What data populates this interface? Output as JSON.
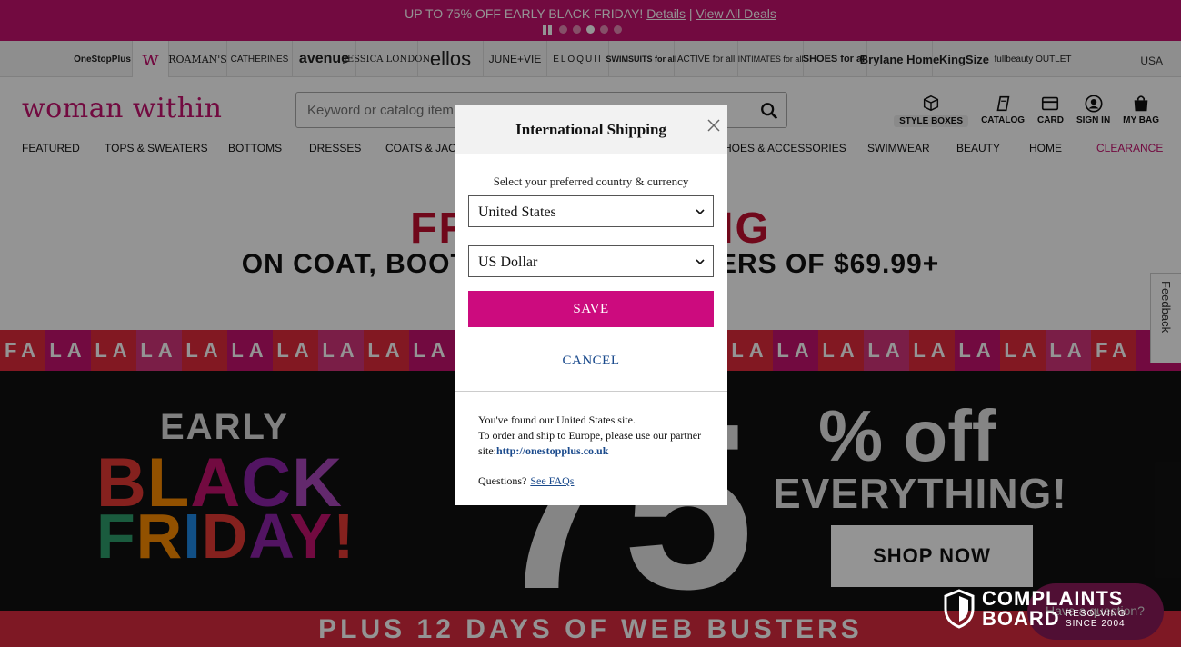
{
  "promo": {
    "text": "UP TO 75% OFF EARLY BLACK FRIDAY!",
    "details_link": "Details",
    "separator": "|",
    "view_all_link": "View All Deals"
  },
  "brands": [
    "OneStopPlus",
    "w",
    "ROAMAN'S",
    "CATHERINES",
    "avenue",
    "JESSICA LONDON",
    "ellos",
    "JUNE+VIE",
    "ELOQUII",
    "SWIMSUITS for all",
    "ACTIVE for all",
    "INTIMATES for all",
    "SHOES for all",
    "Brylane Home",
    "KingSize",
    "fullbeauty OUTLET"
  ],
  "country_code": "USA",
  "header": {
    "logo": "woman within",
    "search_placeholder": "Keyword or catalog item #",
    "icons": {
      "style_boxes": "STYLE BOXES",
      "catalog": "CATALOG",
      "card": "CARD",
      "sign_in": "SIGN IN",
      "bag": "MY BAG"
    }
  },
  "nav": [
    "FEATURED",
    "TOPS & SWEATERS",
    "BOTTOMS",
    "DRESSES",
    "COATS & JACKETS",
    "SHOES & ACCESSORIES",
    "SWIMWEAR",
    "BEAUTY",
    "HOME",
    "CLEARANCE"
  ],
  "banner": {
    "free_title": "FREE SHIPPING",
    "free_sub": "ON COAT, BOOT & SWEATER ORDERS OF $69.99+",
    "fala": "FA LA LA LA LA LA LA LA LA LA LA LA LA LA LA LA LA LA LA LA LA LA LA LA LA FA L",
    "early": "EARLY",
    "black": "BLACK",
    "friday": "FRIDAY!",
    "big_number": "75",
    "off": "% off",
    "everything": "EVERYTHING!",
    "shop_now": "SHOP NOW",
    "plus": "PLUS 12 DAYS OF WEB BUSTERS"
  },
  "feedback": "Feedback",
  "chat": "Have a question?",
  "modal": {
    "title": "International Shipping",
    "select_label": "Select your preferred country & currency",
    "country": "United States",
    "currency": "US Dollar",
    "save": "SAVE",
    "cancel": "CANCEL",
    "info_line1": "You've found our United States site.",
    "info_line2": "To order and ship to Europe, please use our partner site:",
    "partner_link": "http://onestopplus.co.uk",
    "questions": "Questions?",
    "faq_link": "See FAQs"
  },
  "watermark": {
    "line1": "COMPLAINTS",
    "line2": "BOARD",
    "tag1": "RESOLVING",
    "tag2": "SINCE 2004"
  },
  "colors": {
    "brand": "#c5126e",
    "save_button": "#cc0b7e",
    "link": "#1a4a8c",
    "free_red": "#c20f2f"
  }
}
